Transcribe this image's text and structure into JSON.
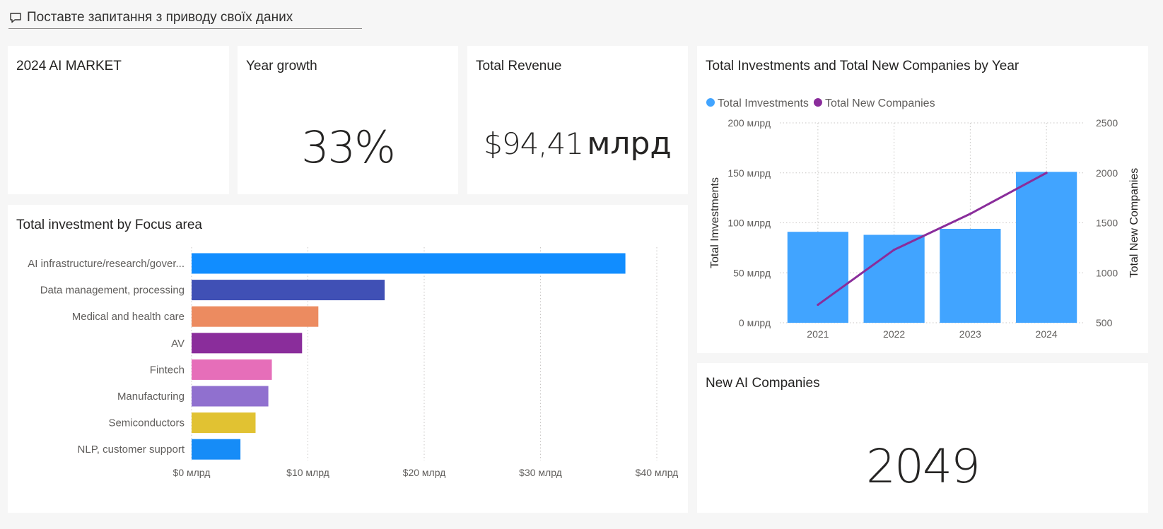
{
  "qa": {
    "prompt": "Поставте запитання з приводу своїх даних",
    "icon": "chat-bubble-icon"
  },
  "cards": {
    "market": {
      "title": "2024 AI MARKET"
    },
    "growth": {
      "title": "Year growth",
      "value": "33%"
    },
    "revenue": {
      "title": "Total Revenue",
      "value_number": "$94,41",
      "value_unit": "млрд"
    },
    "new_companies": {
      "title": "New AI Companies",
      "value": "2049"
    }
  },
  "colors": {
    "investments_bar": "#41A4FF",
    "new_companies_line": "#8A2D9B"
  },
  "charts": {
    "focus": {
      "title": "Total investment by Focus area"
    },
    "combo": {
      "title": "Total Investments and Total New Companies by Year"
    }
  },
  "chart_data": [
    {
      "type": "bar",
      "orientation": "horizontal",
      "title": "Total investment by Focus area",
      "xlabel": "",
      "ylabel": "",
      "categories": [
        "AI infrastructure/research/gover...",
        "Data management, processing",
        "Medical and health care",
        "AV",
        "Fintech",
        "Manufacturing",
        "Semiconductors",
        "NLP, customer support"
      ],
      "values": [
        37.3,
        16.6,
        10.9,
        9.5,
        6.9,
        6.6,
        5.5,
        4.2
      ],
      "bar_colors": [
        "#118DFF",
        "#4050B5",
        "#EC8B60",
        "#8A2D9B",
        "#E66EB9",
        "#9070CF",
        "#E1C232",
        "#168CF7"
      ],
      "xlim": [
        0,
        40
      ],
      "x_ticks": [
        "$0 млрд",
        "$10 млрд",
        "$20 млрд",
        "$30 млрд",
        "$40 млрд"
      ],
      "x_tick_values": [
        0,
        10,
        20,
        30,
        40
      ],
      "grid": "vertical dotted"
    },
    {
      "type": "bar+line",
      "title": "Total Investments and Total New Companies by Year",
      "categories": [
        "2021",
        "2022",
        "2023",
        "2024"
      ],
      "series": [
        {
          "name": "Total Imvestments",
          "type": "bar",
          "axis": "left",
          "values": [
            91,
            88,
            94,
            151
          ]
        },
        {
          "name": "Total New Companies",
          "type": "line",
          "axis": "right",
          "values": [
            680,
            1230,
            1590,
            2000
          ]
        }
      ],
      "ylabel_left": "Total Imvestments",
      "ylabel_right": "Total New Companies",
      "ylim_left": [
        0,
        200
      ],
      "ylim_right": [
        500,
        2500
      ],
      "y_ticks_left": [
        "0 млрд",
        "50 млрд",
        "100 млрд",
        "150 млрд",
        "200 млрд"
      ],
      "y_tick_values_left": [
        0,
        50,
        100,
        150,
        200
      ],
      "y_ticks_right": [
        "500",
        "1000",
        "1500",
        "2000",
        "2500"
      ],
      "y_tick_values_right": [
        500,
        1000,
        1500,
        2000,
        2500
      ],
      "legend": "top-left",
      "grid": "dotted"
    }
  ]
}
